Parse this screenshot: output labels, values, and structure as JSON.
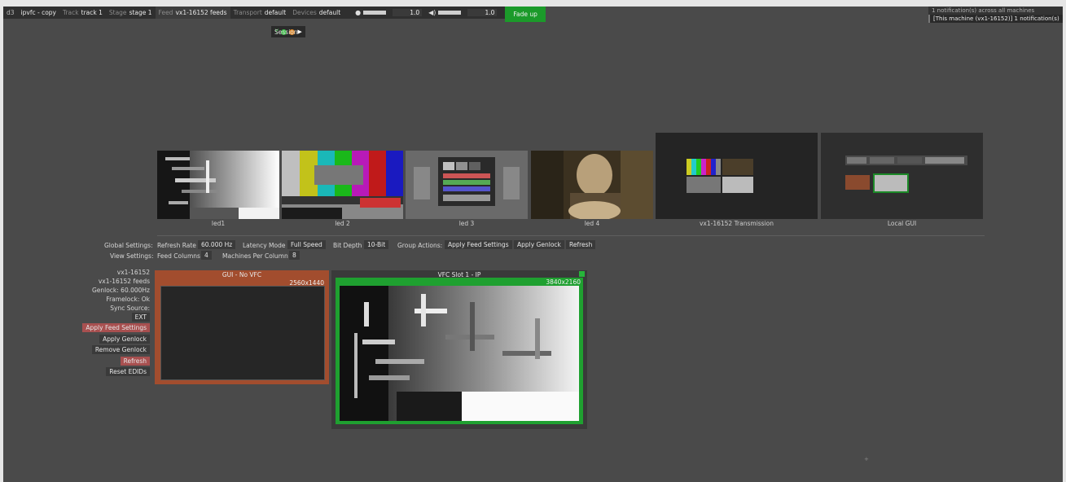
{
  "topbar": {
    "logo": "d3",
    "project": "ipvfc - copy",
    "track_key": "Track",
    "track_val": "track 1",
    "stage_key": "Stage",
    "stage_val": "stage 1",
    "feed_key": "Feed",
    "feed_val": "vx1-16152 feeds",
    "transport_key": "Transport",
    "transport_val": "default",
    "devices_key": "Devices",
    "devices_val": "default",
    "brightness_value": "1.0",
    "volume_value": "1.0",
    "fade_label": "Fade up"
  },
  "notifications": {
    "all": "1 notification(s) across all machines",
    "local": "[This machine (vx1-16152)] 1 notification(s)"
  },
  "session": {
    "label": "Session"
  },
  "thumbnails": [
    {
      "caption": "led1"
    },
    {
      "caption": "led 2"
    },
    {
      "caption": "led 3"
    },
    {
      "caption": "led 4"
    },
    {
      "caption": "vx1-16152 Transmission"
    },
    {
      "caption": "Local GUI"
    }
  ],
  "global_settings": {
    "label": "Global Settings:",
    "refresh_rate_label": "Refresh Rate",
    "refresh_rate": "60.000 Hz",
    "latency_label": "Latency Mode",
    "latency": "Full Speed",
    "bit_depth_label": "Bit Depth",
    "bit_depth": "10-Bit",
    "group_actions_label": "Group Actions:",
    "apply_feed": "Apply Feed Settings",
    "apply_genlock": "Apply Genlock",
    "refresh": "Refresh"
  },
  "view_settings": {
    "label": "View Settings:",
    "feed_columns_label": "Feed Columns",
    "feed_columns": "4",
    "machines_per_column_label": "Machines Per Column",
    "machines_per_column": "8"
  },
  "machine": {
    "name": "vx1-16152",
    "feeds": "vx1-16152 feeds",
    "genlock": "Genlock: 60.000Hz",
    "framelock": "Framelock: Ok",
    "sync_source_label": "Sync Source:",
    "sync_source": "EXT",
    "apply_feed": "Apply Feed Settings",
    "apply_genlock": "Apply Genlock",
    "remove_genlock": "Remove Genlock",
    "refresh": "Refresh",
    "reset_edids": "Reset EDIDs"
  },
  "outputs": {
    "gui": {
      "title": "GUI - No VFC",
      "resolution": "2560x1440"
    },
    "vfc": {
      "title": "VFC Slot 1 - IP",
      "resolution": "3840x2160"
    }
  },
  "colors": {
    "accent_green": "#1b9a2a",
    "gui_orange": "#a24d2e",
    "button_red": "#a85050"
  }
}
